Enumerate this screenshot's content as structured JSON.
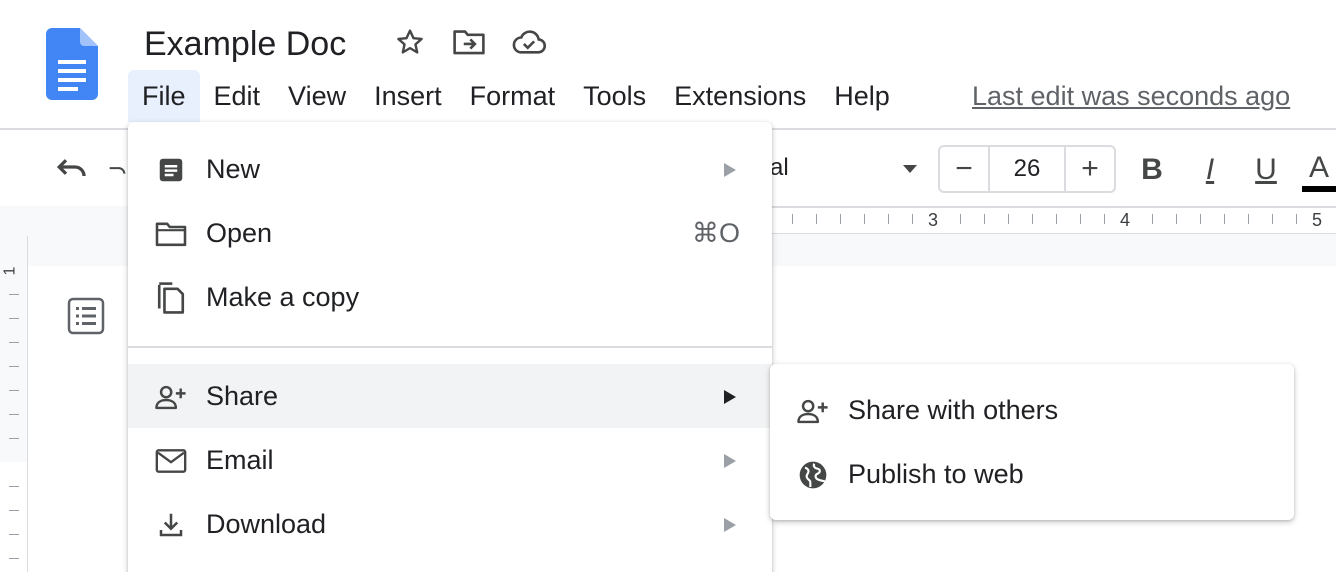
{
  "doc": {
    "title": "Example Doc",
    "icons": {
      "logo": "google-docs-logo",
      "star": "star-icon",
      "move": "move-to-folder-icon",
      "cloud": "cloud-saved-icon"
    }
  },
  "menubar": {
    "items": [
      {
        "label": "File",
        "active": true
      },
      {
        "label": "Edit"
      },
      {
        "label": "View"
      },
      {
        "label": "Insert"
      },
      {
        "label": "Format"
      },
      {
        "label": "Tools"
      },
      {
        "label": "Extensions"
      },
      {
        "label": "Help"
      }
    ],
    "last_edit": "Last edit was seconds ago"
  },
  "toolbar": {
    "font_partial": "al",
    "font_size": "26",
    "decrease_label": "−",
    "increase_label": "+",
    "bold_label": "B",
    "italic_label": "I",
    "underline_label": "U",
    "text_color_label": "A"
  },
  "ruler": {
    "numbers": [
      "3",
      "4",
      "5"
    ],
    "vertical_number": "1"
  },
  "file_menu": {
    "items": [
      {
        "label": "New",
        "icon": "document-icon",
        "has_submenu": true
      },
      {
        "label": "Open",
        "icon": "folder-icon",
        "shortcut": "⌘O"
      },
      {
        "label": "Make a copy",
        "icon": "copy-icon"
      },
      {
        "label": "Share",
        "icon": "person-add-icon",
        "has_submenu": true,
        "highlighted": true
      },
      {
        "label": "Email",
        "icon": "email-icon",
        "has_submenu": true
      },
      {
        "label": "Download",
        "icon": "download-icon",
        "has_submenu": true
      }
    ]
  },
  "share_submenu": {
    "items": [
      {
        "label": "Share with others",
        "icon": "person-add-icon"
      },
      {
        "label": "Publish to web",
        "icon": "globe-icon"
      }
    ]
  },
  "colors": {
    "accent": "#4285f4",
    "active_menu_bg": "#e8f0fe",
    "hover_bg": "#f1f3f4",
    "text": "#202124",
    "muted": "#5f6368"
  }
}
